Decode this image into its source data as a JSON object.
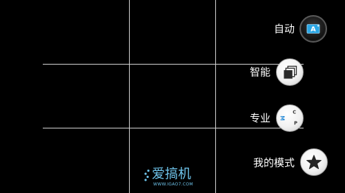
{
  "modes": {
    "auto": {
      "label": "自动",
      "icon": "auto-mode-icon"
    },
    "smart": {
      "label": "智能",
      "icon": "smart-scene-icon"
    },
    "pro": {
      "label": "专业",
      "icon": "pro-mode-dial-icon",
      "dial_letters": [
        "C",
        "P",
        "M"
      ]
    },
    "my": {
      "label": "我的模式",
      "icon": "star-icon"
    }
  },
  "watermark": {
    "title": "爱搞机",
    "url": "WWW.IGAO7.COM"
  },
  "colors": {
    "background": "#000000",
    "grid": "#d8d8d8",
    "auto_icon_accent": "#2aa7e6",
    "watermark": "#6ec3ea",
    "dial_accent": "#2f8fd8"
  }
}
